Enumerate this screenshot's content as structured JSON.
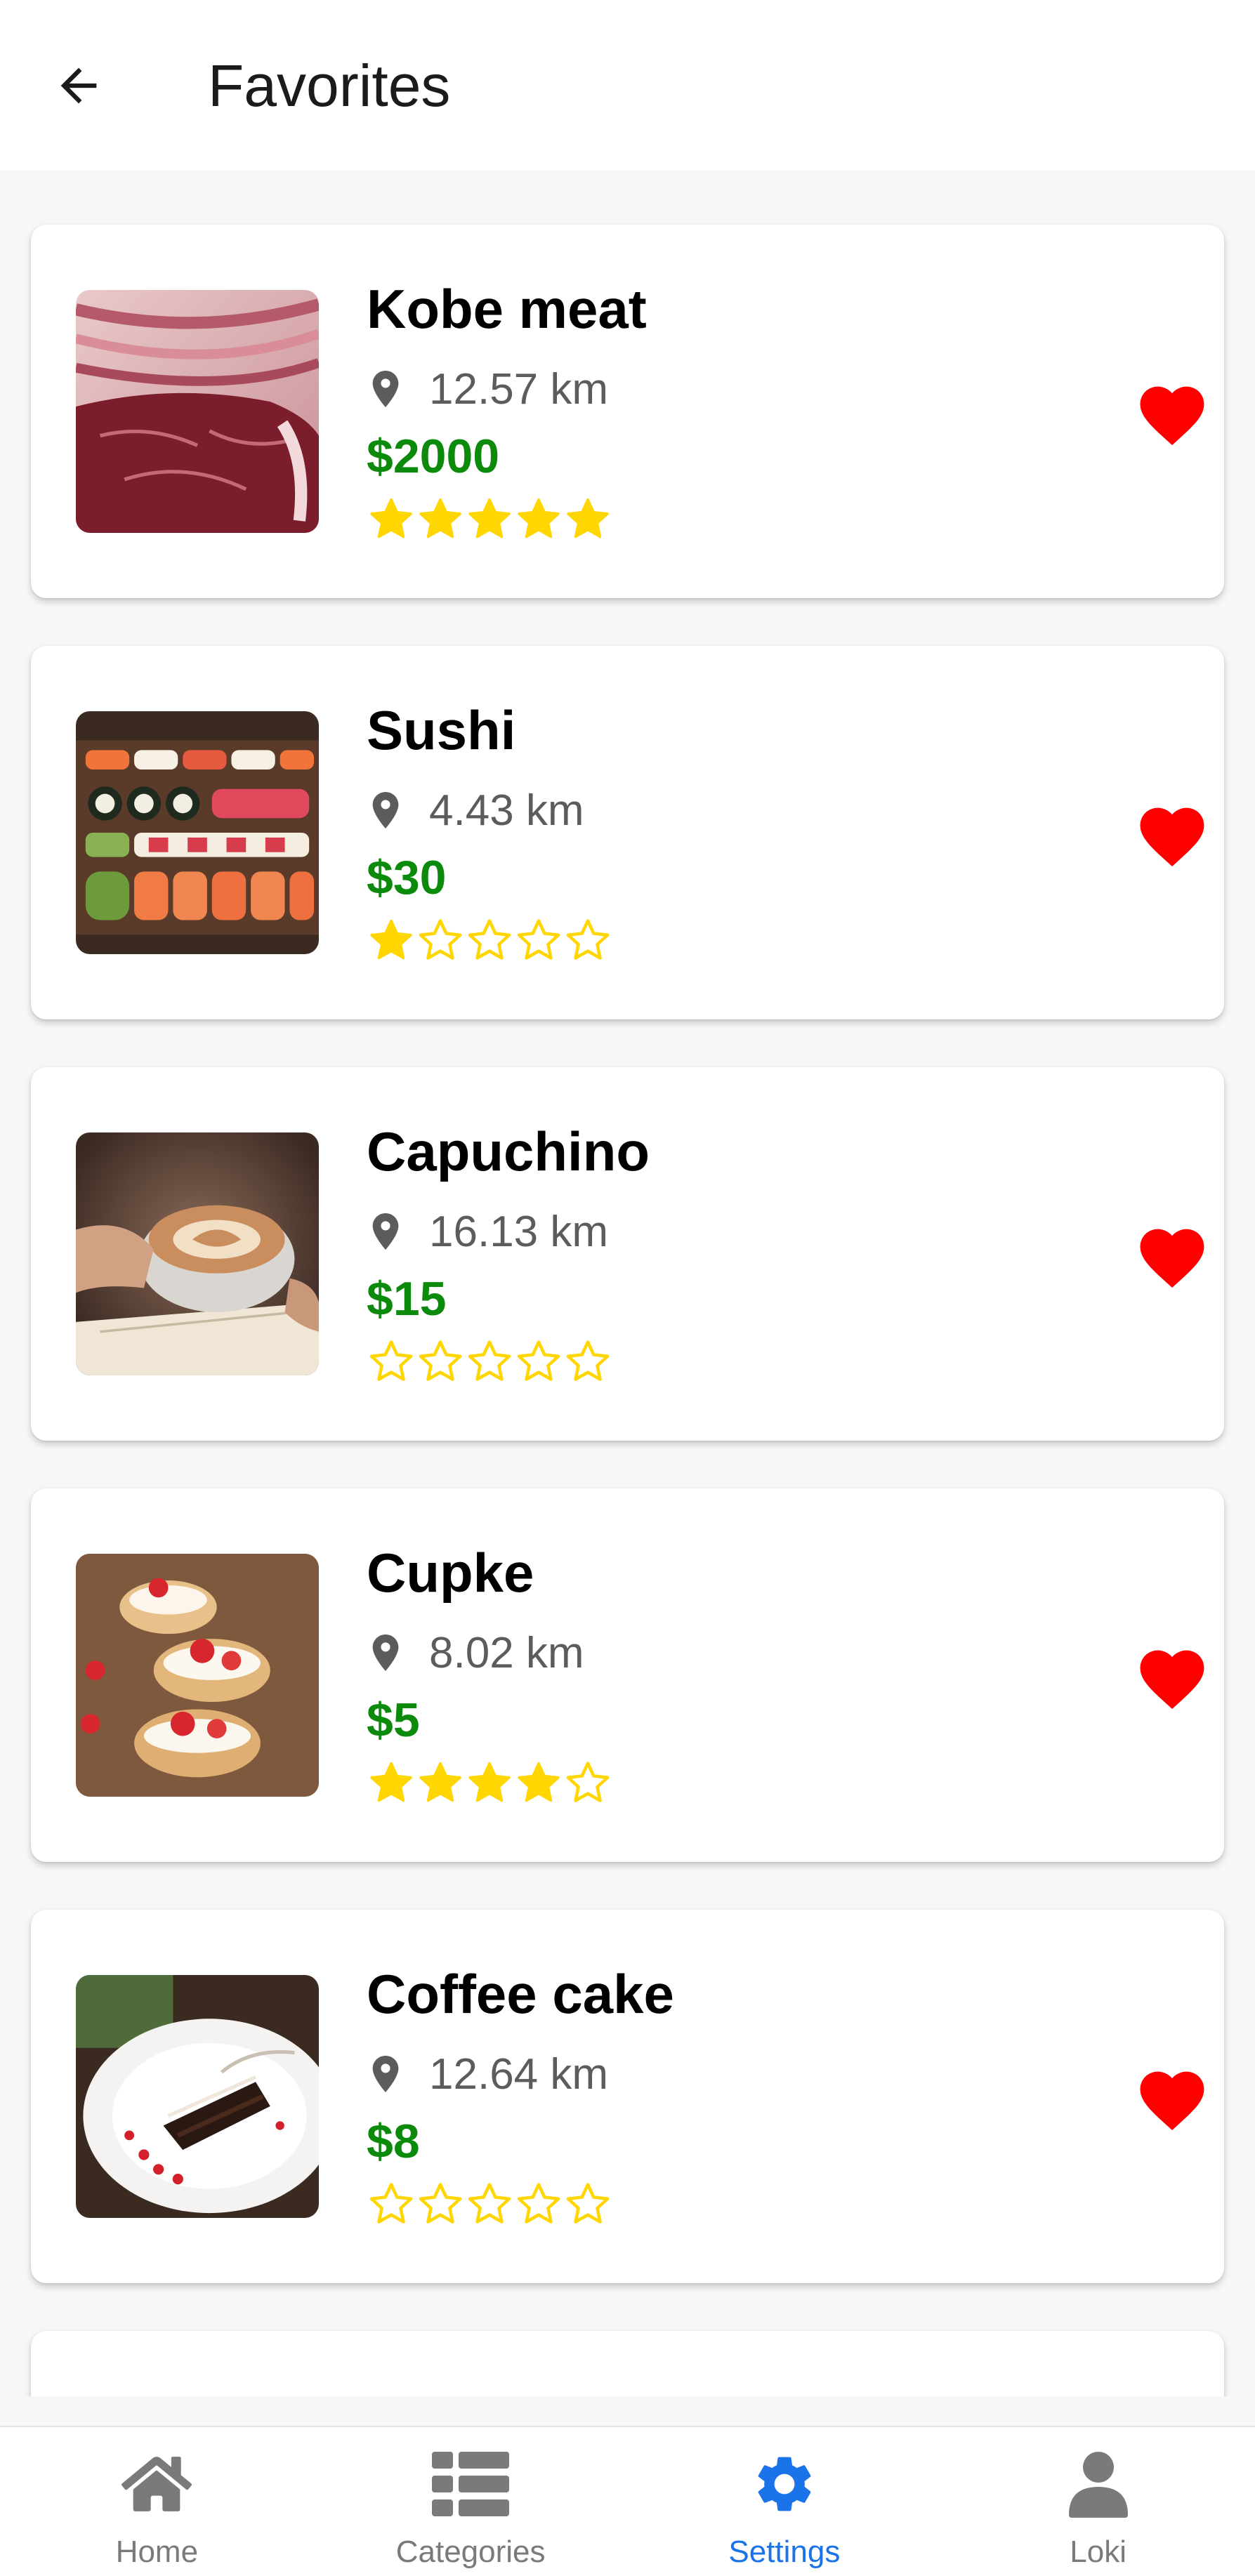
{
  "header": {
    "title": "Favorites",
    "back_icon": "arrow-left-icon"
  },
  "items": [
    {
      "name": "Kobe meat",
      "distance": "12.57 km",
      "price": "$2000",
      "rating": 5,
      "favorite": true,
      "image": "kobe-beef-photo"
    },
    {
      "name": "Sushi",
      "distance": "4.43 km",
      "price": "$30",
      "rating": 1,
      "favorite": true,
      "image": "sushi-platter-photo"
    },
    {
      "name": "Capuchino",
      "distance": "16.13 km",
      "price": "$15",
      "rating": 0,
      "favorite": true,
      "image": "cappuccino-cup-photo"
    },
    {
      "name": "Cupke",
      "distance": "8.02 km",
      "price": "$5",
      "rating": 4,
      "favorite": true,
      "image": "strawberry-cream-puffs-photo"
    },
    {
      "name": "Coffee cake",
      "distance": "12.64 km",
      "price": "$8",
      "rating": 0,
      "favorite": true,
      "image": "chocolate-cake-slice-photo"
    }
  ],
  "rating_max": 5,
  "nav": [
    {
      "label": "Home",
      "icon": "home-icon",
      "active": false
    },
    {
      "label": "Categories",
      "icon": "list-icon",
      "active": false
    },
    {
      "label": "Settings",
      "icon": "gear-icon",
      "active": true
    },
    {
      "label": "Loki",
      "icon": "user-icon",
      "active": false
    }
  ],
  "colors": {
    "price": "#0b8a0b",
    "star": "#FFD600",
    "heart": "#ff0000",
    "active_nav": "#1a73e8",
    "inactive_nav": "#7a7a7a"
  }
}
